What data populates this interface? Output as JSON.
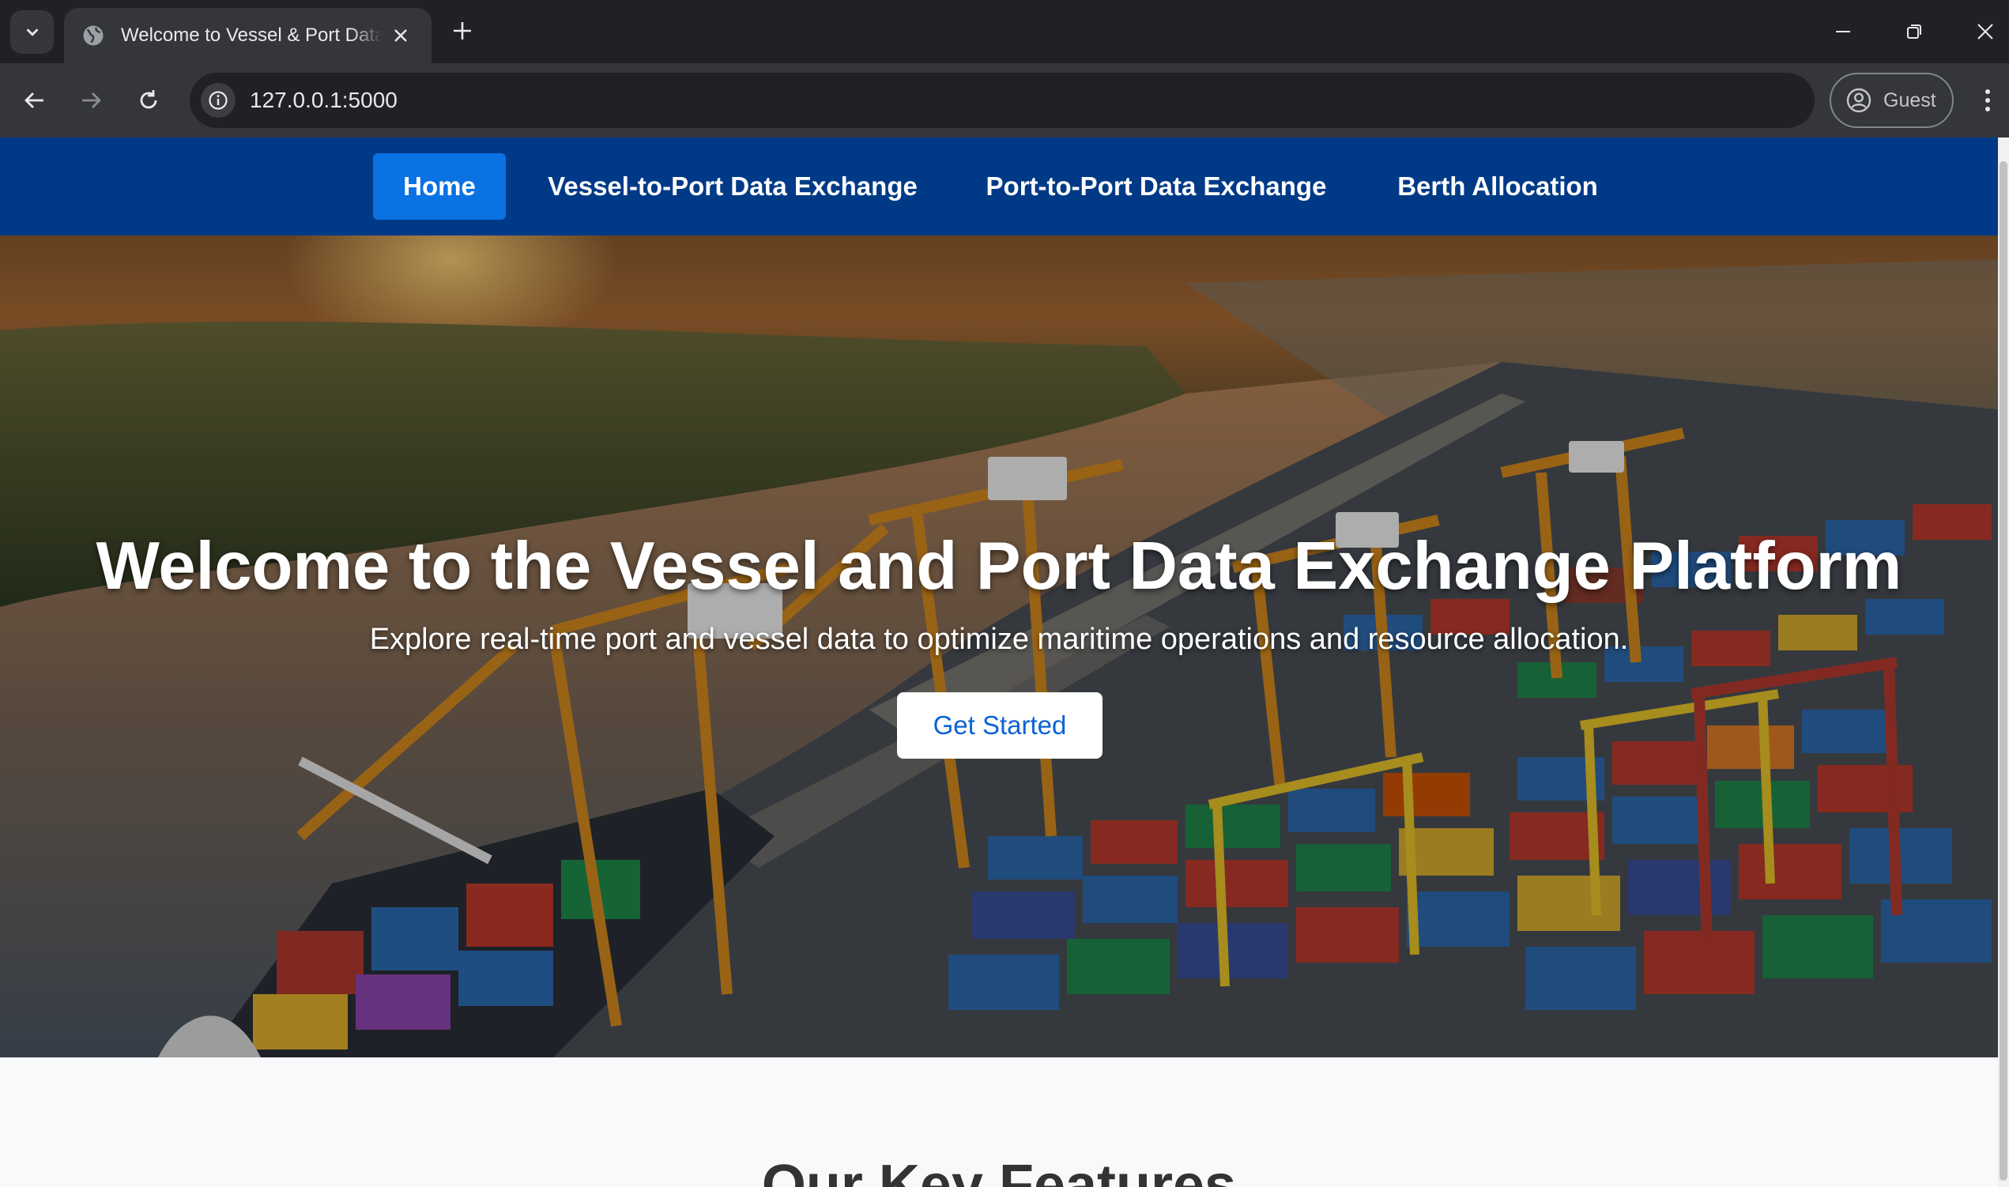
{
  "browser": {
    "tab_title": "Welcome to Vessel & Port Data Exchange",
    "url": "127.0.0.1:5000",
    "profile_label": "Guest"
  },
  "site_nav": {
    "items": [
      {
        "label": "Home",
        "active": true
      },
      {
        "label": "Vessel-to-Port Data Exchange",
        "active": false
      },
      {
        "label": "Port-to-Port Data Exchange",
        "active": false
      },
      {
        "label": "Berth Allocation",
        "active": false
      }
    ]
  },
  "hero": {
    "title": "Welcome to the Vessel and Port Data Exchange Platform",
    "subtitle": "Explore real-time port and vessel data to optimize maritime operations and resource allocation.",
    "cta_label": "Get Started"
  },
  "features": {
    "heading": "Our Key Features"
  },
  "colors": {
    "chrome_dark": "#202124",
    "chrome_bar": "#35363a",
    "nav_background": "#003a87",
    "nav_active": "#0b72e3",
    "cta_text": "#0b63d6"
  },
  "icons": {
    "tab_search": "chevron-down-icon",
    "favicon": "globe-icon",
    "tab_close": "close-icon",
    "new_tab": "plus-icon",
    "minimize": "minimize-icon",
    "restore": "restore-icon",
    "close_window": "close-icon",
    "back": "arrow-left-icon",
    "forward": "arrow-right-icon",
    "reload": "reload-icon",
    "site_info": "info-icon",
    "profile": "account-circle-icon",
    "menu": "more-vertical-icon"
  }
}
